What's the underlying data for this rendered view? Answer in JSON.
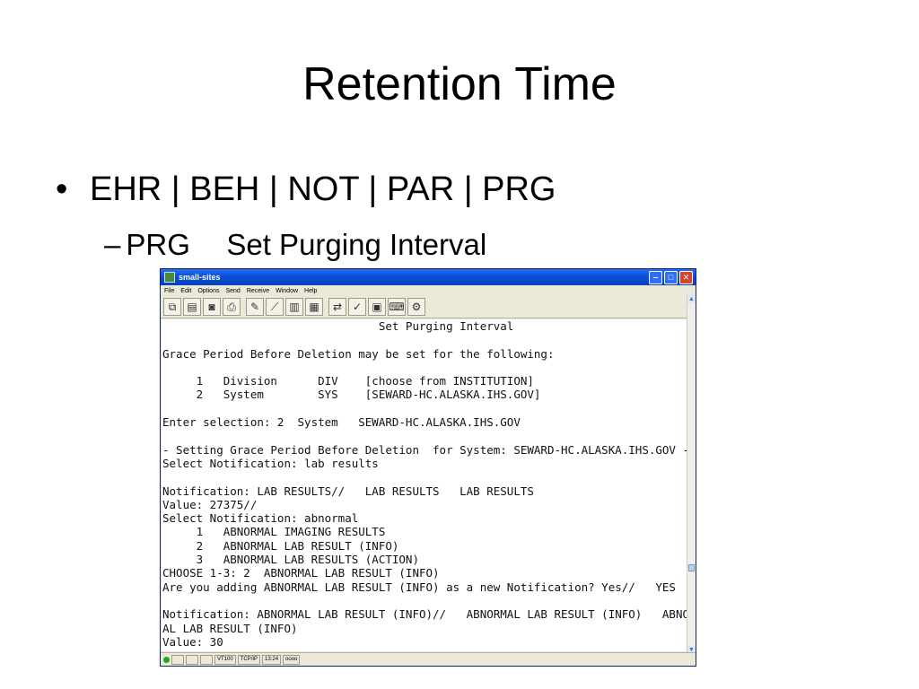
{
  "slide": {
    "title": "Retention Time",
    "bullet": "EHR | BEH | NOT | PAR | PRG",
    "sub_bullet": {
      "code": "PRG",
      "text": "Set Purging Interval"
    }
  },
  "window": {
    "title": "small-sites",
    "menu": [
      "File",
      "Edit",
      "Options",
      "Send",
      "Receive",
      "Window",
      "Help"
    ],
    "toolbar_icons": [
      "copy-icon",
      "paste-icon",
      "capture-icon",
      "print-icon",
      "macro-icon",
      "edit-icon",
      "clipboard-icon",
      "table-icon",
      "transfer-icon",
      "spell-icon",
      "display-icon",
      "keyboard-icon",
      "settings-icon"
    ],
    "terminal_lines": [
      "                                Set Purging Interval",
      "",
      "Grace Period Before Deletion may be set for the following:",
      "",
      "     1   Division      DIV    [choose from INSTITUTION]",
      "     2   System        SYS    [SEWARD-HC.ALASKA.IHS.GOV]",
      "",
      "Enter selection: 2  System   SEWARD-HC.ALASKA.IHS.GOV",
      "",
      "- Setting Grace Period Before Deletion  for System: SEWARD-HC.ALASKA.IHS.GOV -",
      "Select Notification: lab results",
      "",
      "Notification: LAB RESULTS//   LAB RESULTS   LAB RESULTS",
      "Value: 27375//",
      "Select Notification: abnormal",
      "     1   ABNORMAL IMAGING RESULTS",
      "     2   ABNORMAL LAB RESULT (INFO)",
      "     3   ABNORMAL LAB RESULTS (ACTION)",
      "CHOOSE 1-3: 2  ABNORMAL LAB RESULT (INFO)",
      "Are you adding ABNORMAL LAB RESULT (INFO) as a new Notification? Yes//   YES",
      "",
      "Notification: ABNORMAL LAB RESULT (INFO)//   ABNORMAL LAB RESULT (INFO)   ABNORM",
      "AL LAB RESULT (INFO)",
      "Value: 30"
    ],
    "status": {
      "terminal_type": "VT100",
      "protocol": "TCP/IP",
      "time": "13:24",
      "indicator": "oooo"
    }
  }
}
